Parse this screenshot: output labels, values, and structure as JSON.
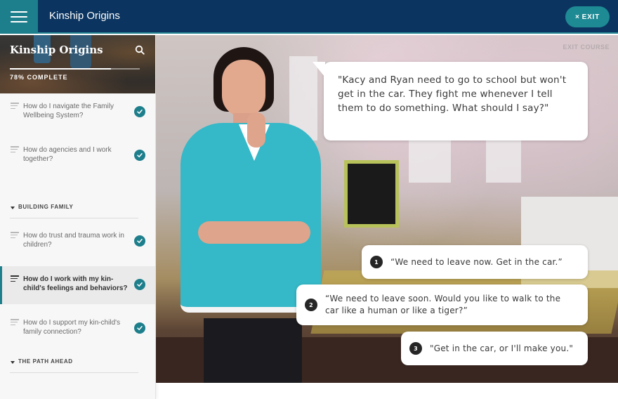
{
  "header": {
    "title": "Kinship Origins",
    "exit_label": "EXIT",
    "exit_icon": "close-icon",
    "menu_icon": "hamburger-icon"
  },
  "sidebar": {
    "course_title": "Kinship Origins",
    "search_icon": "search-icon",
    "progress_percent": 78,
    "progress_label": "78% COMPLETE",
    "items": [
      {
        "type": "lesson",
        "label": "How do I navigate the Family Wellbeing System?",
        "completed": true,
        "active": false
      },
      {
        "type": "lesson",
        "label": "How do agencies and I work together?",
        "completed": true,
        "active": false
      },
      {
        "type": "section",
        "label": "BUILDING FAMILY",
        "expanded": true
      },
      {
        "type": "lesson",
        "label": "How do trust and trauma work in children?",
        "completed": true,
        "active": false
      },
      {
        "type": "lesson",
        "label": "How do I work with my kin-child's feelings and behaviors?",
        "completed": true,
        "active": true
      },
      {
        "type": "lesson",
        "label": "How do I support my kin-child's family connection?",
        "completed": true,
        "active": false
      },
      {
        "type": "section",
        "label": "THE PATH AHEAD",
        "expanded": true
      }
    ]
  },
  "stage": {
    "exit_course_label": "EXIT COURSE",
    "prompt": "\"Kacy and Ryan need to go to school but won't get in the car. They fight me whenever I tell them to do something. What should I say?\"",
    "choices": [
      {
        "number": "1",
        "text": "“We need to leave now. Get in the car.”"
      },
      {
        "number": "2",
        "text": "“We need to leave soon. Would you like to walk to the car like a human or like a tiger?”"
      },
      {
        "number": "3",
        "text": "\"Get in the car, or I'll make you.\""
      }
    ]
  },
  "colors": {
    "header_bg": "#0b3560",
    "accent_teal": "#1e7f8c",
    "exit_button": "#1e8a94",
    "sidebar_bg": "#f7f7f7",
    "choice_number_bg": "#262626"
  }
}
